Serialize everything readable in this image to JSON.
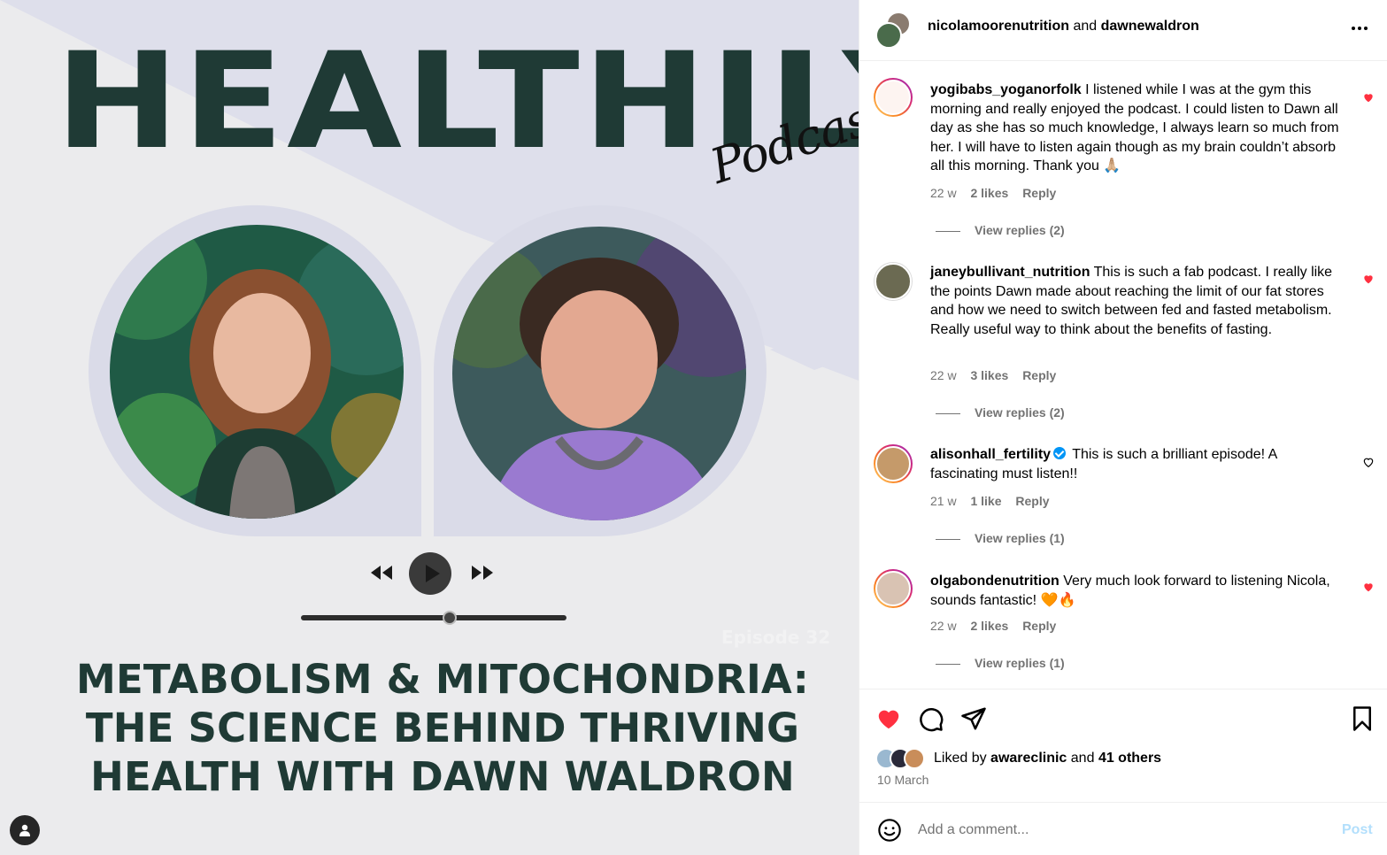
{
  "image": {
    "title": "HEALTHILY",
    "script_word": "Podcast",
    "episode_ghost": "Episode 32",
    "episode_title_lines": [
      "METABOLISM & MITOCHONDRIA:",
      "THE SCIENCE BEHIND THRIVING",
      "HEALTH WITH DAWN WALDRON"
    ],
    "player": {
      "progress": 0.56
    },
    "colors": {
      "title": "#1f3a35",
      "bg": "#ebebed",
      "accent_shape": "#dcdcea"
    }
  },
  "header": {
    "user1": "nicolamoorenutrition",
    "joiner": "and",
    "user2": "dawnewaldron",
    "more_icon": "more-horizontal-icon"
  },
  "comments": [
    {
      "username": "yogibabs_yoganorfolk",
      "text": "I listened while I was at the gym this morning and really enjoyed the podcast. I could listen to Dawn all day as she has so much knowledge, I always learn so much from her. I will have to listen again though as my brain couldn’t absorb all this morning. Thank you 🙏🏼",
      "time": "22 w",
      "likes": "2 likes",
      "reply": "Reply",
      "view_replies": "View replies (2)",
      "liked": true,
      "verified": false
    },
    {
      "username": "janeybullivant_nutrition",
      "text": "This is such a fab podcast. I really like the points Dawn made about reaching the limit of our fat stores and how we need to switch between fed and fasted metabolism. Really useful way to think about the benefits of fasting.",
      "time": "22 w",
      "likes": "3 likes",
      "reply": "Reply",
      "view_replies": "View replies (2)",
      "liked": true,
      "verified": false
    },
    {
      "username": "alisonhall_fertility",
      "text": "This is such a brilliant episode! A fascinating must listen!!",
      "time": "21 w",
      "likes": "1 like",
      "reply": "Reply",
      "view_replies": "View replies (1)",
      "liked": false,
      "verified": true
    },
    {
      "username": "olgabondenutrition",
      "text": "Very much look forward to listening Nicola, sounds fantastic! 🧡🔥",
      "time": "22 w",
      "likes": "2 likes",
      "reply": "Reply",
      "view_replies": "View replies (1)",
      "liked": true,
      "verified": false
    }
  ],
  "actions": {
    "liked_by_prefix": "Liked by",
    "liked_by_user": "awareclinic",
    "liked_by_and": "and",
    "liked_by_others": "41 others",
    "date": "10 March",
    "like_color": "#ff3040"
  },
  "composer": {
    "placeholder": "Add a comment...",
    "post_label": "Post",
    "post_color": "#b2dffc"
  }
}
